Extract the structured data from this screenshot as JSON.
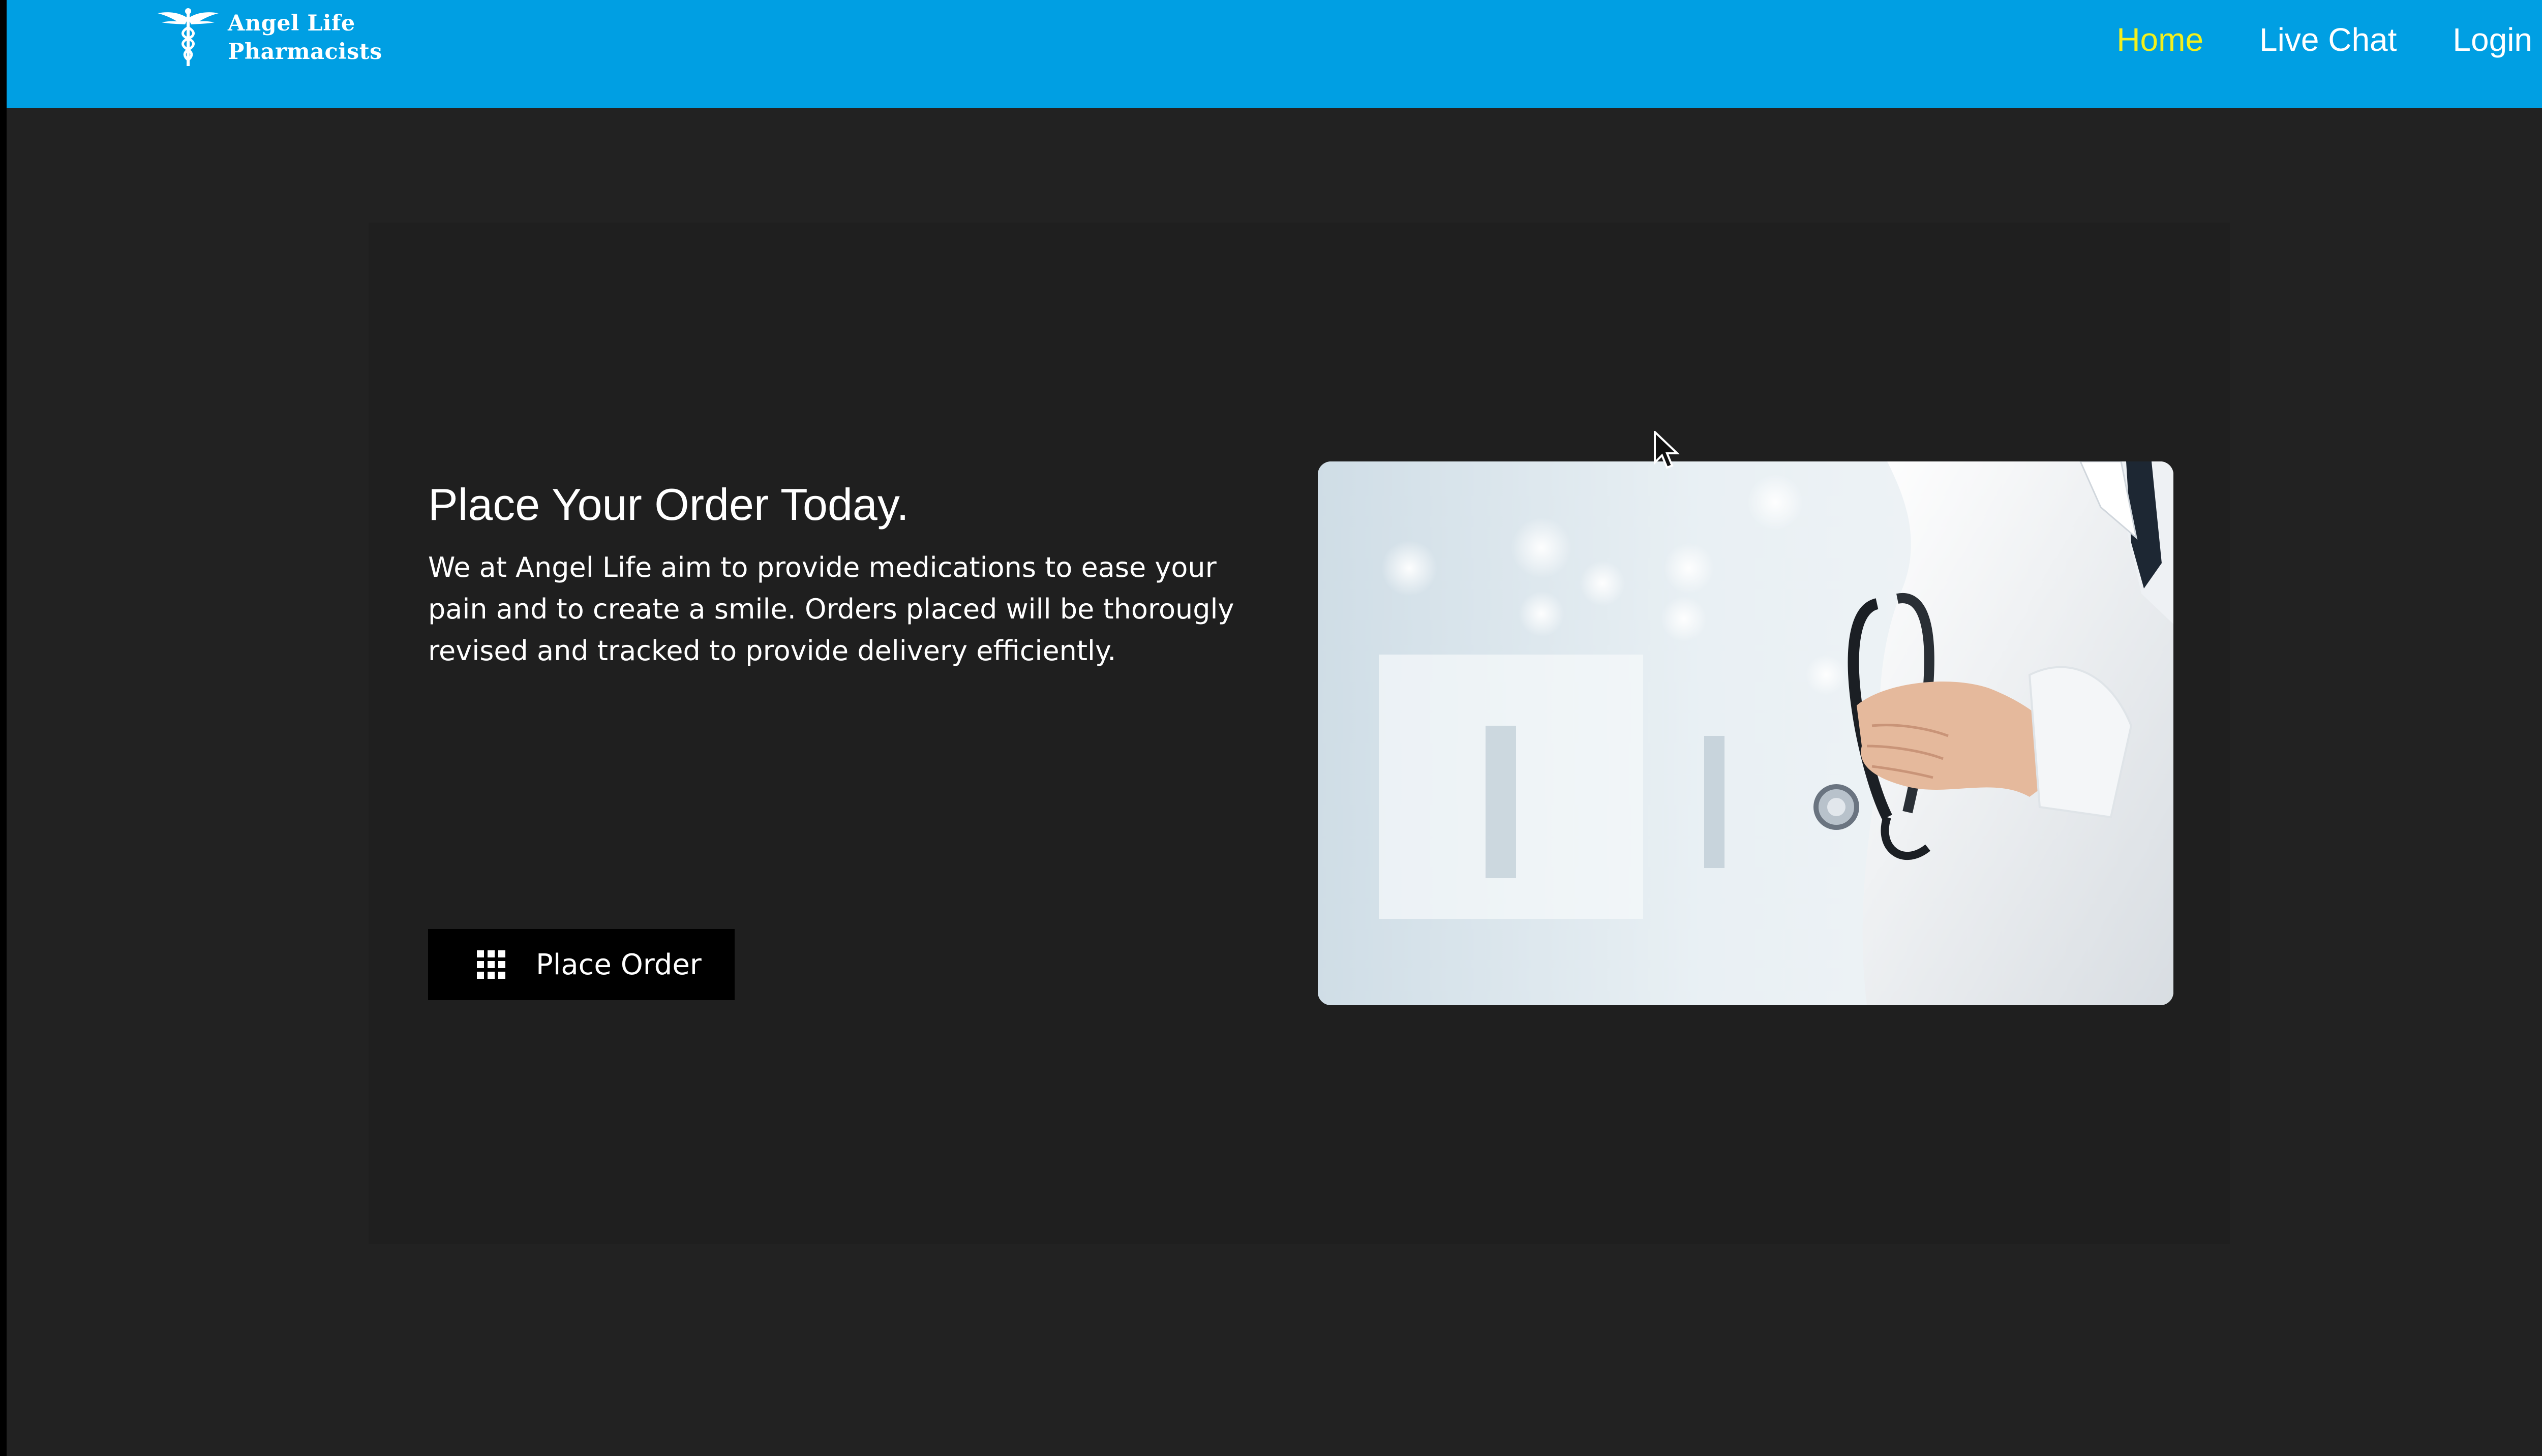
{
  "brand": {
    "line1": "Angel Life",
    "line2": "Pharmacists",
    "logo_icon": "caduceus-icon"
  },
  "nav": {
    "items": [
      {
        "label": "Home",
        "active": true
      },
      {
        "label": "Live Chat",
        "active": false
      },
      {
        "label": "Login",
        "active": false
      }
    ]
  },
  "hero": {
    "title": "Place Your Order Today.",
    "description": "We at Angel Life aim to provide medications to ease your pain and to create a smile. Orders placed will be thorougly revised and tracked to provide delivery efficiently.",
    "button_label": "Place Order",
    "button_icon": "grid-icon",
    "image_subject": "doctor-with-stethoscope"
  },
  "colors": {
    "navbar": "#009fe3",
    "active_link": "#f3f01c",
    "page_background": "#222222",
    "card_background": "#1f1f1f",
    "button_background": "#000000"
  }
}
